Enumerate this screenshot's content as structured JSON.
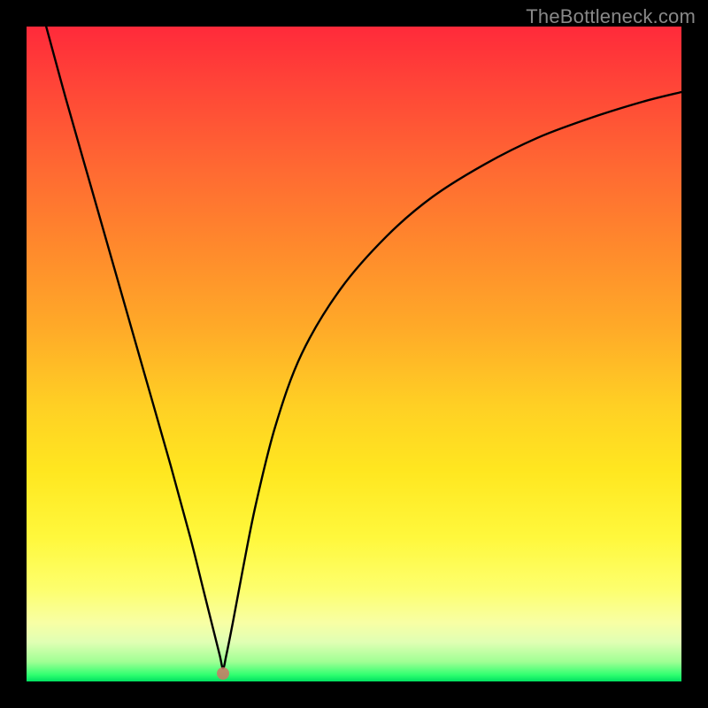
{
  "watermark": "TheBottleneck.com",
  "chart_data": {
    "type": "line",
    "title": "",
    "xlabel": "",
    "ylabel": "",
    "xlim": [
      0,
      100
    ],
    "ylim": [
      0,
      100
    ],
    "grid": false,
    "legend": false,
    "series": [
      {
        "name": "bottleneck-curve",
        "x": [
          3,
          6,
          10,
          14,
          18,
          22,
          25,
          27,
          28.5,
          29.5,
          30,
          30.5,
          31.5,
          33,
          35,
          38,
          42,
          48,
          55,
          62,
          70,
          78,
          86,
          94,
          100
        ],
        "y": [
          100,
          89,
          75,
          61,
          47,
          33,
          22,
          14,
          8,
          4,
          2,
          4,
          9,
          17,
          27,
          39,
          50,
          60,
          68,
          74,
          79,
          83,
          86,
          88.5,
          90
        ]
      }
    ],
    "marker": {
      "x": 30,
      "y": 1.2,
      "name": "optimal-point"
    },
    "colors": {
      "gradient_top": "#ff2a3a",
      "gradient_mid": "#ffd024",
      "gradient_bottom": "#00e060",
      "curve": "#000000",
      "dot": "#cc7766",
      "frame": "#000000"
    }
  }
}
